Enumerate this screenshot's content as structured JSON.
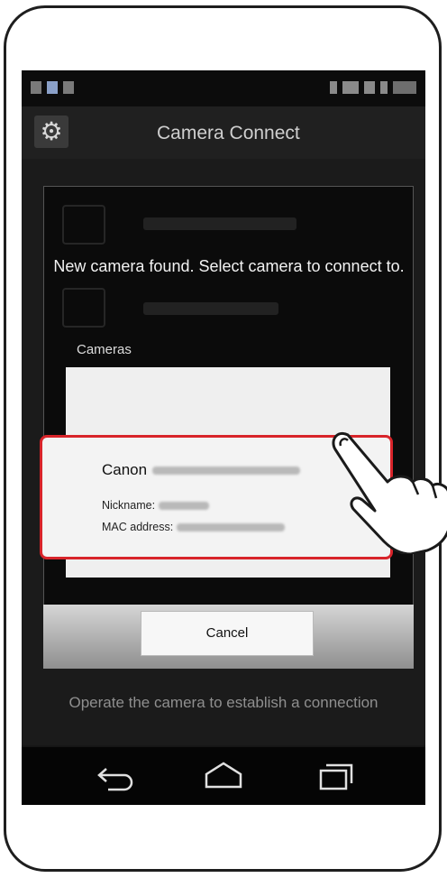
{
  "app": {
    "title": "Camera Connect"
  },
  "icons": {
    "settings": "gear-icon",
    "back": "back-icon",
    "home": "home-icon",
    "recents": "recents-icon",
    "hand": "pointing-hand-icon"
  },
  "dialog": {
    "message": "New camera found. Select camera to connect to.",
    "cameras_label": "Cameras",
    "camera": {
      "name_prefix": "Canon",
      "nickname_label": "Nickname:",
      "mac_label": "MAC address:"
    },
    "cancel_label": "Cancel"
  },
  "hint": "Operate the camera to establish a connection",
  "colors": {
    "selection_border": "#d8242a",
    "screen_bg": "#161616"
  }
}
